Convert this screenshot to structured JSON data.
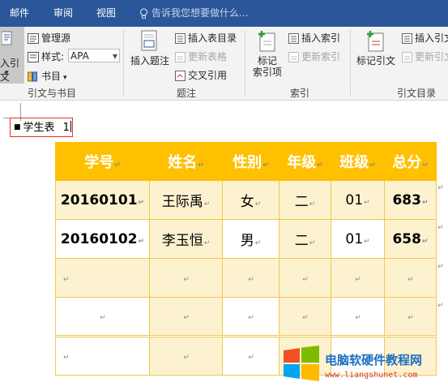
{
  "tabs": [
    "邮件",
    "审阅",
    "视图"
  ],
  "tell_me": "告诉我您想要做什么...",
  "ribbon": {
    "insert_citation": {
      "line1": "入引文",
      "dropdown": "▾"
    },
    "manage_sources": "管理源",
    "style_label": "样式:",
    "style_value": "APA",
    "bibliography": "书目",
    "group_citations": "引文与书目",
    "insert_caption": "插入题注",
    "insert_table_of_figures": "插入表目录",
    "update_table": "更新表格",
    "cross_reference": "交叉引用",
    "group_captions": "题注",
    "mark_entry": {
      "line1": "标记",
      "line2": "索引项"
    },
    "insert_index": "插入索引",
    "update_index": "更新索引",
    "group_index": "索引",
    "mark_citation": "标记引文",
    "insert_toa": "插入引文",
    "update_toa": "更新引文",
    "group_toa": "引文目录"
  },
  "document": {
    "caption_text": "学生表",
    "caption_number": "1",
    "table": {
      "headers": [
        "学号",
        "姓名",
        "性别",
        "年级",
        "班级",
        "总分"
      ],
      "rows": [
        [
          "20160101",
          "王际禹",
          "女",
          "二",
          "01",
          "683"
        ],
        [
          "20160102",
          "李玉恒",
          "男",
          "二",
          "01",
          "658"
        ]
      ],
      "cell_mark": "↵"
    }
  },
  "watermark": {
    "title": "电脑软硬件教程网",
    "url": "www.liangshunet.com"
  },
  "colors": {
    "accent": "#2b579a",
    "table_header": "#ffc000",
    "table_shade": "#fdf2d0",
    "caption_border": "#d9342b"
  }
}
